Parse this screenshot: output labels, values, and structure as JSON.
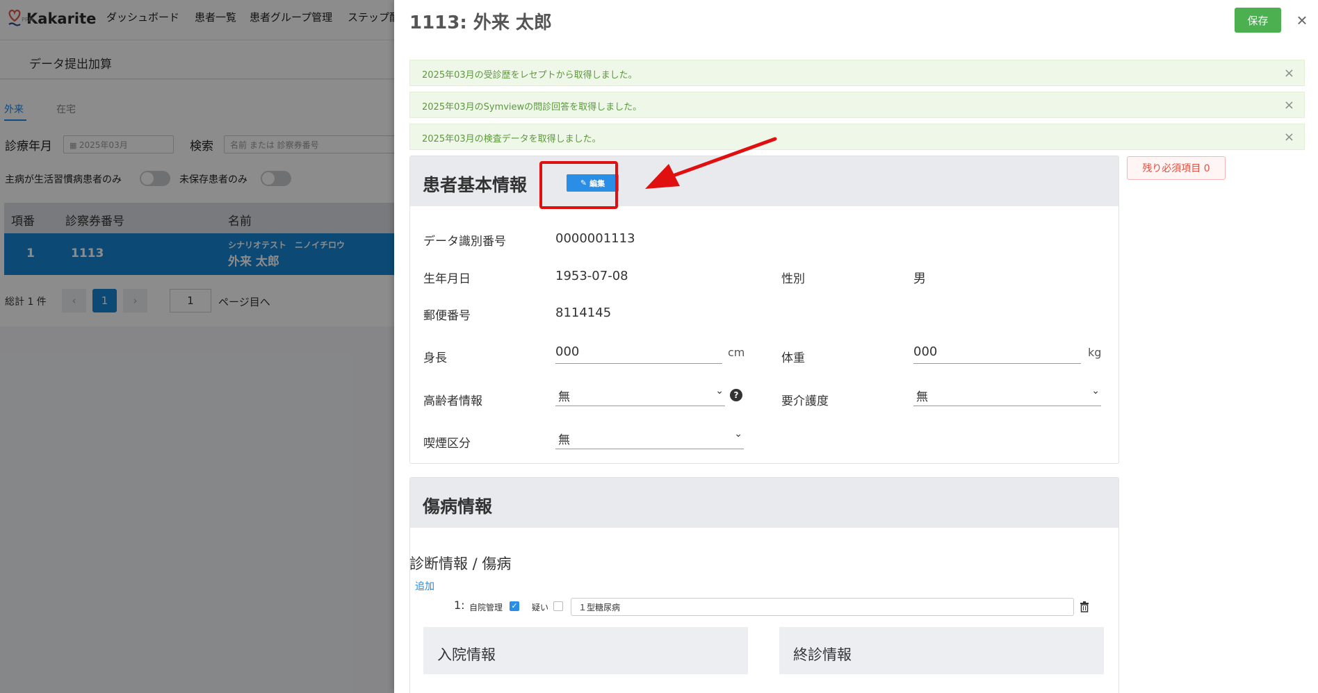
{
  "app": {
    "brand": "Kakarite",
    "brand_sub": "PRM",
    "nav": [
      "ダッシュボード",
      "患者一覧",
      "患者グループ管理",
      "ステップ配"
    ],
    "page_title": "データ提出加算"
  },
  "tabs": [
    "外来",
    "在宅"
  ],
  "filters": {
    "month_label": "診療年月",
    "month_value": "2025年03月",
    "search_label": "検索",
    "search_placeholder": "名前 または 診察券番号",
    "toggle1_label": "主病が生活習慣病患者のみ",
    "toggle2_label": "未保存患者のみ"
  },
  "table": {
    "headers": [
      "項番",
      "診察券番号",
      "名前"
    ],
    "rows": [
      {
        "index": "1",
        "card_no": "1113",
        "kana": "シナリオテスト　ニノイチロウ",
        "name": "外来 太郎"
      }
    ]
  },
  "pager": {
    "total": "総計 1 件",
    "prev": "‹",
    "current": "1",
    "next": "›",
    "jump_value": "1",
    "jump_label": "ページ目へ"
  },
  "drawer": {
    "title": "1113: 外来 太郎",
    "save_label": "保存",
    "close_label": "×",
    "alerts": [
      "2025年03月の受診歴をレセプトから取得しました。",
      "2025年03月のSymviewの問診回答を取得しました。",
      "2025年03月の検査データを取得しました。"
    ],
    "remaining_badge": "残り必須項目 0"
  },
  "basic": {
    "title": "患者基本情報",
    "edit_label": "編集",
    "fields": {
      "data_id_label": "データ識別番号",
      "data_id_value": "0000001113",
      "birth_label": "生年月日",
      "birth_value": "1953-07-08",
      "sex_label": "性別",
      "sex_value": "男",
      "zip_label": "郵便番号",
      "zip_value": "8114145",
      "height_label": "身長",
      "height_value": "000",
      "height_unit": "cm",
      "weight_label": "体重",
      "weight_value": "000",
      "weight_unit": "kg",
      "elderly_label": "高齢者情報",
      "elderly_value": "無",
      "care_label": "要介護度",
      "care_value": "無",
      "smoking_label": "喫煙区分",
      "smoking_value": "無"
    }
  },
  "disease": {
    "title": "傷病情報",
    "diag_heading": "診断情報 / 傷病",
    "add_label": "追加",
    "row1_num": "1:",
    "own_label": "自院管理",
    "suspect_label": "疑い",
    "row1_value": "１型糖尿病",
    "admission_title": "入院情報",
    "final_title": "終診情報"
  },
  "colors": {
    "accent": "#1688d6",
    "save": "#4caf50",
    "alert_bg": "#eef7e8",
    "highlight": "#e01010"
  }
}
